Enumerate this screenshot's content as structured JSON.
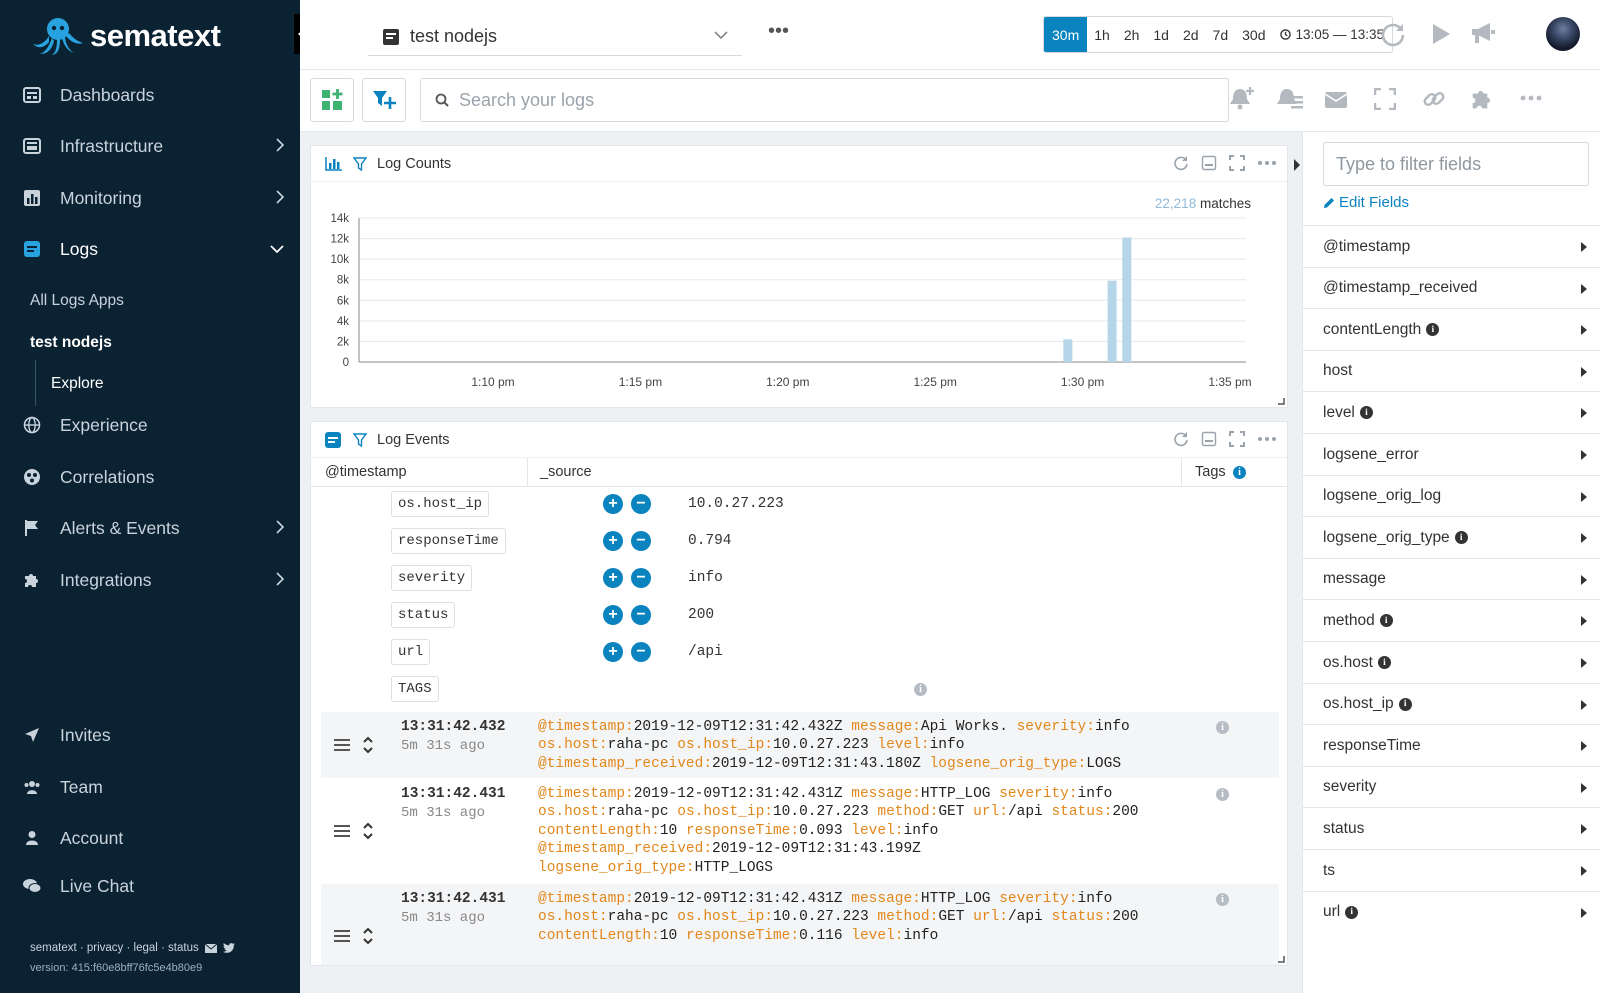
{
  "brand": {
    "name": "sematext"
  },
  "sidebar": {
    "items": [
      {
        "label": "Dashboards"
      },
      {
        "label": "Infrastructure"
      },
      {
        "label": "Monitoring"
      },
      {
        "label": "Logs"
      },
      {
        "label": "Experience"
      },
      {
        "label": "Correlations"
      },
      {
        "label": "Alerts & Events"
      },
      {
        "label": "Integrations"
      }
    ],
    "logs_sub": {
      "all_apps": "All Logs Apps",
      "app": "test nodejs",
      "explore": "Explore"
    },
    "bottom": [
      {
        "label": "Invites"
      },
      {
        "label": "Team"
      },
      {
        "label": "Account"
      },
      {
        "label": "Live Chat"
      }
    ],
    "footer": {
      "links": "sematext · privacy · legal · status",
      "version": "version: 415:f60e8bff76fc5e4b80e9"
    }
  },
  "topbar": {
    "app_name": "test nodejs",
    "time_buttons": [
      "30m",
      "1h",
      "2h",
      "1d",
      "2d",
      "7d",
      "30d"
    ],
    "selected_time": "30m",
    "time_range": "13:05 — 13:35"
  },
  "search": {
    "placeholder": "Search your logs"
  },
  "log_counts": {
    "title": "Log Counts",
    "matches_count": "22,218",
    "matches_label": "matches"
  },
  "chart_data": {
    "type": "bar",
    "title": "Log Counts",
    "x_tick_labels": [
      "1:10 pm",
      "1:15 pm",
      "1:20 pm",
      "1:25 pm",
      "1:30 pm",
      "1:35 pm"
    ],
    "y_tick_labels": [
      "0",
      "2k",
      "4k",
      "6k",
      "8k",
      "10k",
      "12k",
      "14k"
    ],
    "ylim": [
      0,
      14000
    ],
    "x_domain_minutes": [
      1285,
      1295
    ],
    "bars": [
      {
        "minute": 1289.5,
        "value": 2200
      },
      {
        "minute": 1291.0,
        "value": 7900
      },
      {
        "minute": 1291.5,
        "value": 12100
      }
    ],
    "grid": true,
    "bar_color": "#b5d5e8"
  },
  "log_events": {
    "title": "Log Events",
    "columns": [
      "@timestamp",
      "_source",
      "Tags"
    ],
    "expanded_fields": [
      {
        "name": "os.host_ip",
        "value": "10.0.27.223"
      },
      {
        "name": "responseTime",
        "value": "0.794"
      },
      {
        "name": "severity",
        "value": "info"
      },
      {
        "name": "status",
        "value": "200"
      },
      {
        "name": "url",
        "value": "/api"
      },
      {
        "name": "TAGS",
        "value": ""
      }
    ],
    "events": [
      {
        "time": "13:31:42.432",
        "ago": "5m 31s ago",
        "lines": [
          [
            [
              "@timestamp:",
              "2019-12-09T12:31:42.432Z"
            ],
            [
              "message:",
              "Api Works."
            ],
            [
              "severity:",
              "info"
            ]
          ],
          [
            [
              "os.host:",
              "raha-pc"
            ],
            [
              "os.host_ip:",
              "10.0.27.223"
            ],
            [
              "level:",
              "info"
            ]
          ],
          [
            [
              "@timestamp_received:",
              "2019-12-09T12:31:43.180Z"
            ],
            [
              "logsene_orig_type:",
              "LOGS"
            ]
          ]
        ]
      },
      {
        "time": "13:31:42.431",
        "ago": "5m 31s ago",
        "lines": [
          [
            [
              "@timestamp:",
              "2019-12-09T12:31:42.431Z"
            ],
            [
              "message:",
              "HTTP_LOG"
            ],
            [
              "severity:",
              "info"
            ]
          ],
          [
            [
              "os.host:",
              "raha-pc"
            ],
            [
              "os.host_ip:",
              "10.0.27.223"
            ],
            [
              "method:",
              "GET"
            ],
            [
              "url:",
              "/api"
            ],
            [
              "status:",
              "200"
            ]
          ],
          [
            [
              "contentLength:",
              "10"
            ],
            [
              "responseTime:",
              "0.093"
            ],
            [
              "level:",
              "info"
            ]
          ],
          [
            [
              "@timestamp_received:",
              "2019-12-09T12:31:43.199Z"
            ]
          ],
          [
            [
              "logsene_orig_type:",
              "HTTP_LOGS"
            ]
          ]
        ]
      },
      {
        "time": "13:31:42.431",
        "ago": "5m 31s ago",
        "lines": [
          [
            [
              "@timestamp:",
              "2019-12-09T12:31:42.431Z"
            ],
            [
              "message:",
              "HTTP_LOG"
            ],
            [
              "severity:",
              "info"
            ]
          ],
          [
            [
              "os.host:",
              "raha-pc"
            ],
            [
              "os.host_ip:",
              "10.0.27.223"
            ],
            [
              "method:",
              "GET"
            ],
            [
              "url:",
              "/api"
            ],
            [
              "status:",
              "200"
            ]
          ],
          [
            [
              "contentLength:",
              "10"
            ],
            [
              "responseTime:",
              "0.116"
            ],
            [
              "level:",
              "info"
            ]
          ]
        ]
      }
    ]
  },
  "fields_panel": {
    "filter_placeholder": "Type to filter fields",
    "edit_label": "Edit Fields",
    "fields": [
      {
        "name": "@timestamp",
        "info": false
      },
      {
        "name": "@timestamp_received",
        "info": false
      },
      {
        "name": "contentLength",
        "info": true
      },
      {
        "name": "host",
        "info": false
      },
      {
        "name": "level",
        "info": true
      },
      {
        "name": "logsene_error",
        "info": false
      },
      {
        "name": "logsene_orig_log",
        "info": false
      },
      {
        "name": "logsene_orig_type",
        "info": true
      },
      {
        "name": "message",
        "info": false
      },
      {
        "name": "method",
        "info": true
      },
      {
        "name": "os.host",
        "info": true
      },
      {
        "name": "os.host_ip",
        "info": true
      },
      {
        "name": "responseTime",
        "info": false
      },
      {
        "name": "severity",
        "info": false
      },
      {
        "name": "status",
        "info": false
      },
      {
        "name": "ts",
        "info": false
      },
      {
        "name": "url",
        "info": true
      }
    ]
  },
  "colors": {
    "sidebar_bg": "#0b2233",
    "accent": "#0a83bf",
    "field_key": "#e2871b",
    "bar": "#b5d5e8"
  }
}
